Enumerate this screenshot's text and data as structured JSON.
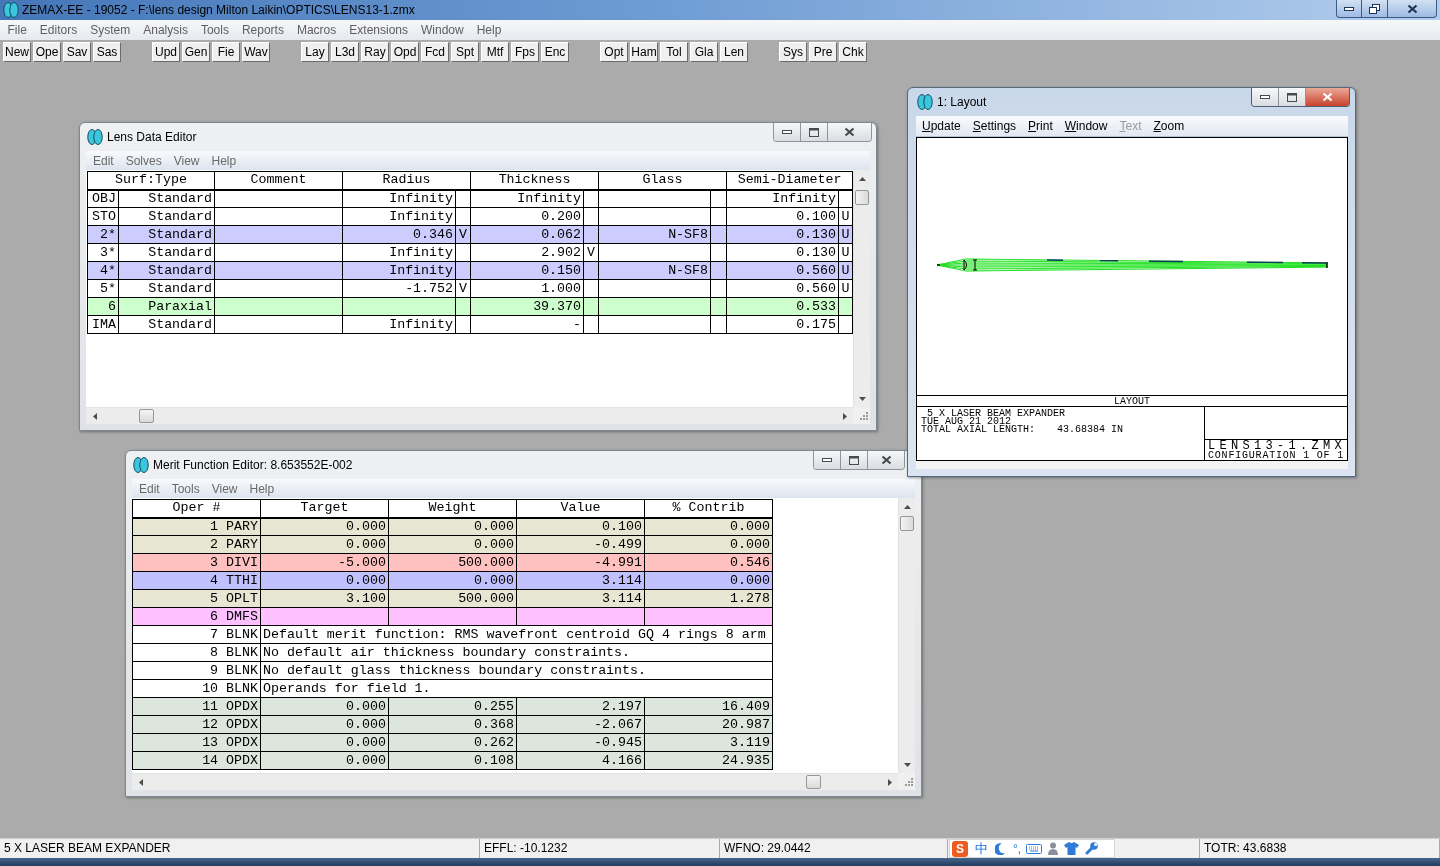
{
  "window": {
    "title": "ZEMAX-EE - 19052 - F:\\lens design Milton Laikin\\OPTICS\\LENS13-1.zmx"
  },
  "menu": [
    "File",
    "Editors",
    "System",
    "Analysis",
    "Tools",
    "Reports",
    "Macros",
    "Extensions",
    "Window",
    "Help"
  ],
  "toolbar": {
    "groups": [
      [
        "New",
        "Ope",
        "Sav",
        "Sas"
      ],
      [
        "Upd",
        "Gen",
        "Fie",
        "Wav"
      ],
      [
        "Lay",
        "L3d",
        "Ray",
        "Opd",
        "Fcd",
        "Spt",
        "Mtf",
        "Fps",
        "Enc"
      ],
      [
        "Opt",
        "Ham",
        "Tol",
        "Gla",
        "Len"
      ],
      [
        "Sys",
        "Pre",
        "Chk"
      ]
    ]
  },
  "layout_window": {
    "title": "1: Layout",
    "active": true,
    "menu": [
      {
        "label": "Update",
        "disabled": false
      },
      {
        "label": "Settings",
        "disabled": false
      },
      {
        "label": "Print",
        "disabled": false
      },
      {
        "label": "Window",
        "disabled": false
      },
      {
        "label": "Text",
        "disabled": true
      },
      {
        "label": "Zoom",
        "disabled": false
      }
    ],
    "plot_title": "LAYOUT",
    "notes": [
      "5 X LASER BEAM EXPANDER",
      "TUE AUG 21 2012"
    ],
    "axial_length_label": "TOTAL AXIAL LENGTH:",
    "axial_length": "43.68384 IN",
    "file": "LENS13-1.ZMX",
    "configuration": "CONFIGURATION 1 OF 1"
  },
  "lens_data_editor": {
    "title": "Lens Data Editor",
    "active": false,
    "menu": [
      "Edit",
      "Solves",
      "View",
      "Help"
    ],
    "columns": [
      "Surf:Type",
      "Comment",
      "Radius",
      "Thickness",
      "Glass",
      "Semi-Diameter"
    ],
    "rows": [
      {
        "surface": "OBJ",
        "type": "Standard",
        "radius": "Infinity",
        "thickness": "Infinity",
        "semi_diameter": "Infinity",
        "color": "#ffffff"
      },
      {
        "surface": "STO",
        "type": "Standard",
        "radius": "Infinity",
        "thickness": "0.200",
        "semi_diameter": "0.100",
        "semi_diameter_solve": "U",
        "color": "#ffffff"
      },
      {
        "surface": "2*",
        "type": "Standard",
        "radius": "0.346",
        "radius_solve": "V",
        "thickness": "0.062",
        "glass": "N-SF8",
        "semi_diameter": "0.130",
        "semi_diameter_solve": "U",
        "color": "#ccccff"
      },
      {
        "surface": "3*",
        "type": "Standard",
        "radius": "Infinity",
        "thickness": "2.902",
        "thickness_solve": "V",
        "semi_diameter": "0.130",
        "semi_diameter_solve": "U",
        "color": "#ffffff"
      },
      {
        "surface": "4*",
        "type": "Standard",
        "radius": "Infinity",
        "thickness": "0.150",
        "glass": "N-SF8",
        "semi_diameter": "0.560",
        "semi_diameter_solve": "U",
        "color": "#ccccff"
      },
      {
        "surface": "5*",
        "type": "Standard",
        "radius": "-1.752",
        "radius_solve": "V",
        "thickness": "1.000",
        "semi_diameter": "0.560",
        "semi_diameter_solve": "U",
        "color": "#ffffff"
      },
      {
        "surface": "6",
        "type": "Paraxial",
        "thickness": "39.370",
        "semi_diameter": "0.533",
        "color": "#ccffcc"
      },
      {
        "surface": "IMA",
        "type": "Standard",
        "radius": "Infinity",
        "thickness": "-",
        "semi_diameter": "0.175",
        "color": "#ffffff"
      }
    ]
  },
  "merit_function_editor": {
    "title": "Merit Function Editor: 8.653552E-002",
    "active": false,
    "menu": [
      "Edit",
      "Tools",
      "View",
      "Help"
    ],
    "columns": [
      "Oper #",
      "Target",
      "Weight",
      "Value",
      "% Contrib"
    ],
    "rows": [
      {
        "kind": "operand",
        "number": "1",
        "operand": "PARY",
        "target": "0.000",
        "weight": "0.000",
        "value": "0.100",
        "contrib": "0.000",
        "color": "#e6e6d2"
      },
      {
        "kind": "operand",
        "number": "2",
        "operand": "PARY",
        "target": "0.000",
        "weight": "0.000",
        "value": "-0.499",
        "contrib": "0.000",
        "color": "#e6e6d2"
      },
      {
        "kind": "operand",
        "number": "3",
        "operand": "DIVI",
        "target": "-5.000",
        "weight": "500.000",
        "value": "-4.991",
        "contrib": "0.546",
        "color": "#ffc0c0"
      },
      {
        "kind": "operand",
        "number": "4",
        "operand": "TTHI",
        "target": "0.000",
        "weight": "0.000",
        "value": "3.114",
        "contrib": "0.000",
        "color": "#c0c0ff"
      },
      {
        "kind": "operand",
        "number": "5",
        "operand": "OPLT",
        "target": "3.100",
        "weight": "500.000",
        "value": "3.114",
        "contrib": "1.278",
        "color": "#e6e6d2"
      },
      {
        "kind": "operand",
        "number": "6",
        "operand": "DMFS",
        "color": "#ffc0ff"
      },
      {
        "kind": "comment",
        "number": "7",
        "operand": "BLNK",
        "comment": "Default merit function: RMS wavefront centroid GQ 4 rings 8 arm",
        "color": "#ffffff"
      },
      {
        "kind": "comment",
        "number": "8",
        "operand": "BLNK",
        "comment": "No default air thickness boundary constraints.",
        "color": "#ffffff"
      },
      {
        "kind": "comment",
        "number": "9",
        "operand": "BLNK",
        "comment": "No default glass thickness boundary constraints.",
        "color": "#ffffff"
      },
      {
        "kind": "comment",
        "number": "10",
        "operand": "BLNK",
        "comment": "Operands for field 1.",
        "color": "#ffffff"
      },
      {
        "kind": "operand",
        "number": "11",
        "operand": "OPDX",
        "target": "0.000",
        "weight": "0.255",
        "value": "2.197",
        "contrib": "16.409",
        "color": "#dce6dc"
      },
      {
        "kind": "operand",
        "number": "12",
        "operand": "OPDX",
        "target": "0.000",
        "weight": "0.368",
        "value": "-2.067",
        "contrib": "20.987",
        "color": "#dce6dc"
      },
      {
        "kind": "operand",
        "number": "13",
        "operand": "OPDX",
        "target": "0.000",
        "weight": "0.262",
        "value": "-0.945",
        "contrib": "3.119",
        "color": "#dce6dc"
      },
      {
        "kind": "operand",
        "number": "14",
        "operand": "OPDX",
        "target": "0.000",
        "weight": "0.108",
        "value": "4.166",
        "contrib": "24.935",
        "color": "#dce6dc"
      }
    ]
  },
  "status_bar": {
    "title": "5 X LASER BEAM EXPANDER",
    "effl": "EFFL: -10.1232",
    "wfno": "WFNO: 29.0442",
    "totr": "TOTR: 43.6838"
  },
  "ime_bar": {
    "logo": "S",
    "mode": "中",
    "punctuation": "°,"
  }
}
